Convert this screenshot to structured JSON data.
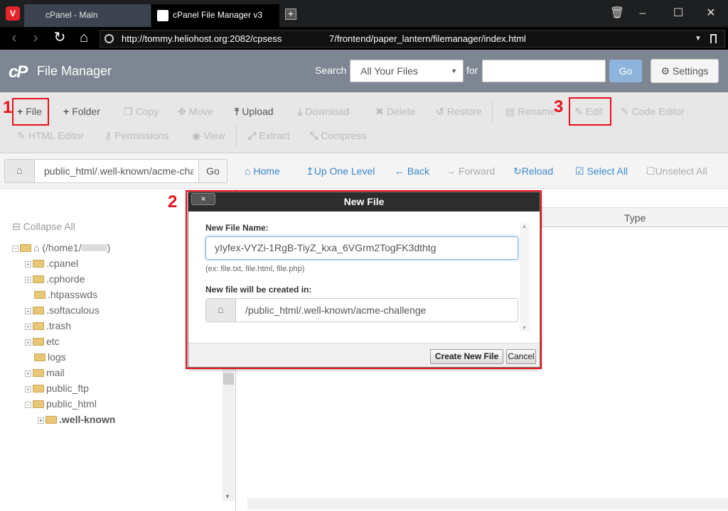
{
  "browser": {
    "logo": "V",
    "tabs": [
      {
        "label": "cPanel - Main"
      },
      {
        "label": "cPanel File Manager v3"
      }
    ],
    "url_part1": "http://tommy.heliohost.org:2082/cpsess",
    "url_part2": "7/frontend/paper_lantern/filemanager/index.html"
  },
  "header": {
    "logo": "cP",
    "title": "File Manager",
    "search_label": "Search",
    "search_scope": "All Your Files",
    "for_label": "for",
    "go_label": "Go",
    "settings_label": "Settings"
  },
  "toolbar": {
    "row1": [
      {
        "label": "File",
        "icon": "plus-icon",
        "enabled": true
      },
      {
        "label": "Folder",
        "icon": "plus-icon",
        "enabled": true
      },
      {
        "label": "Copy",
        "icon": "copy-icon",
        "enabled": false
      },
      {
        "label": "Move",
        "icon": "move-icon",
        "enabled": false
      },
      {
        "label": "Upload",
        "icon": "upload-icon",
        "enabled": true
      },
      {
        "label": "Download",
        "icon": "download-icon",
        "enabled": false
      },
      {
        "label": "Delete",
        "icon": "x-icon",
        "enabled": false
      },
      {
        "label": "Restore",
        "icon": "undo-icon",
        "enabled": false
      },
      {
        "label": "Rename",
        "icon": "file-icon",
        "enabled": false
      },
      {
        "label": "Edit",
        "icon": "pencil-icon",
        "enabled": false
      },
      {
        "label": "Code Editor",
        "icon": "edit-icon",
        "enabled": false
      }
    ],
    "row2": [
      {
        "label": "HTML Editor",
        "icon": "edit-icon",
        "enabled": false
      },
      {
        "label": "Permissions",
        "icon": "key-icon",
        "enabled": false
      },
      {
        "label": "View",
        "icon": "eye-icon",
        "enabled": false
      },
      {
        "label": "Extract",
        "icon": "expand-icon",
        "enabled": false
      },
      {
        "label": "Compress",
        "icon": "compress-icon",
        "enabled": false
      }
    ]
  },
  "navbar": {
    "path": "public_html/.well-known/acme-challenge",
    "go_label": "Go",
    "buttons": [
      {
        "label": "Home",
        "enabled": true
      },
      {
        "label": "Up One Level",
        "enabled": true
      },
      {
        "label": "Back",
        "enabled": true
      },
      {
        "label": "Forward",
        "enabled": false
      },
      {
        "label": "Reload",
        "enabled": true
      },
      {
        "label": "Select All",
        "enabled": true
      },
      {
        "label": "Unselect All",
        "enabled": false
      }
    ]
  },
  "tree": {
    "collapse_label": "Collapse All",
    "root": "(/home1/",
    "root_end": ")",
    "items": [
      {
        "label": ".cpanel",
        "expandable": true
      },
      {
        "label": ".cphorde",
        "expandable": true
      },
      {
        "label": ".htpasswds",
        "expandable": false
      },
      {
        "label": ".softaculous",
        "expandable": true
      },
      {
        "label": ".trash",
        "expandable": true
      },
      {
        "label": "etc",
        "expandable": true
      },
      {
        "label": "logs",
        "expandable": false
      },
      {
        "label": "mail",
        "expandable": true
      },
      {
        "label": "public_ftp",
        "expandable": true
      },
      {
        "label": "public_html",
        "expandable": false
      }
    ],
    "child": ".well-known"
  },
  "filelist": {
    "type_header": "Type"
  },
  "dialog": {
    "title": "New File",
    "close_label": "×",
    "name_label": "New File Name:",
    "name_value": "yIyfex-VYZi-1RgB-TiyZ_kxa_6VGrm2TogFK3dthtg",
    "hint": "(ex: file.txt, file.html, file.php)",
    "location_label": "New file will be created in:",
    "location_value": "/public_html/.well-known/acme-challenge",
    "create_label": "Create New File",
    "cancel_label": "Cancel"
  },
  "annotations": {
    "n1": "1",
    "n2": "2",
    "n3": "3",
    "color": "#e8101c"
  }
}
